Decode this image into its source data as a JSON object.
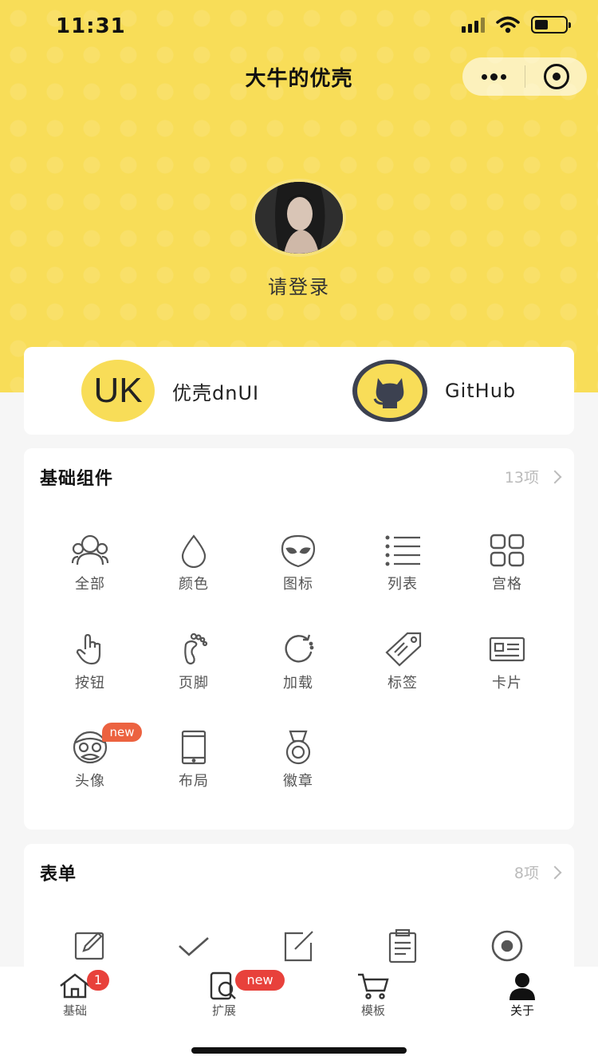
{
  "status_bar": {
    "time": "11:31"
  },
  "nav": {
    "title": "大牛的优壳"
  },
  "profile": {
    "login_text": "请登录"
  },
  "links": [
    {
      "logo_text": "UK",
      "label": "优壳dnUI"
    },
    {
      "label": "GitHub"
    }
  ],
  "sections": {
    "basic": {
      "title": "基础组件",
      "count": "13项",
      "items": [
        {
          "label": "全部",
          "icon": "group-icon"
        },
        {
          "label": "颜色",
          "icon": "drop-icon"
        },
        {
          "label": "图标",
          "icon": "alien-icon"
        },
        {
          "label": "列表",
          "icon": "list-icon"
        },
        {
          "label": "宫格",
          "icon": "grid-icon"
        },
        {
          "label": "按钮",
          "icon": "tap-icon"
        },
        {
          "label": "页脚",
          "icon": "footprint-icon"
        },
        {
          "label": "加载",
          "icon": "loading-icon"
        },
        {
          "label": "标签",
          "icon": "tag-icon"
        },
        {
          "label": "卡片",
          "icon": "card-icon"
        },
        {
          "label": "头像",
          "icon": "face-icon",
          "badge": "new"
        },
        {
          "label": "布局",
          "icon": "tablet-icon"
        },
        {
          "label": "徽章",
          "icon": "medal-icon"
        }
      ]
    },
    "form": {
      "title": "表单",
      "count": "8项",
      "items": [
        {
          "icon": "edit-icon"
        },
        {
          "icon": "check-icon"
        },
        {
          "icon": "compose-icon"
        },
        {
          "icon": "clipboard-icon"
        },
        {
          "icon": "radio-icon"
        }
      ]
    }
  },
  "tabbar": [
    {
      "label": "基础",
      "icon": "home-icon",
      "badge": "1"
    },
    {
      "label": "扩展",
      "icon": "search-phone-icon",
      "badge": "new"
    },
    {
      "label": "模板",
      "icon": "cart-icon"
    },
    {
      "label": "关于",
      "icon": "user-icon",
      "active": true
    }
  ]
}
